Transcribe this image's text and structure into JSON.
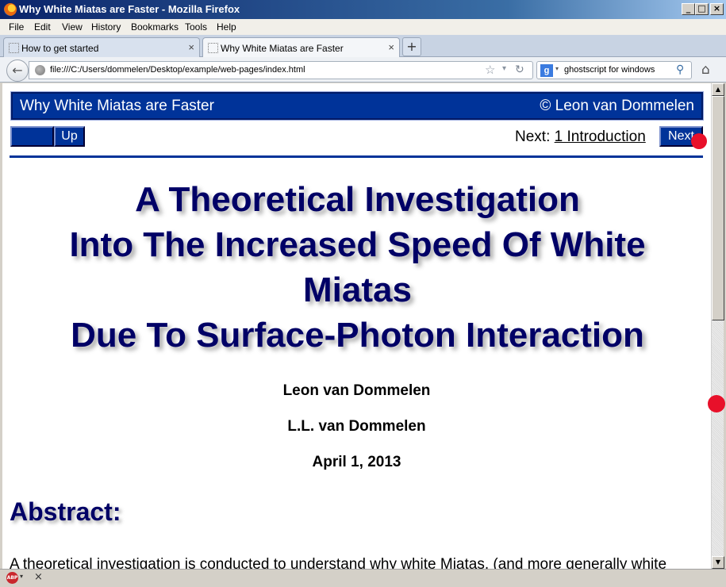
{
  "window": {
    "title": "Why White Miatas are Faster - Mozilla Firefox",
    "min": "_",
    "max": "□",
    "close": "×"
  },
  "menu": [
    "File",
    "Edit",
    "View",
    "History",
    "Bookmarks",
    "Tools",
    "Help"
  ],
  "tabs": [
    {
      "label": "How to get started",
      "close": "×"
    },
    {
      "label": "Why White Miatas are Faster",
      "close": "×"
    }
  ],
  "new_tab": "+",
  "nav": {
    "back": "←",
    "url": "file:///C:/Users/dommelen/Desktop/example/web-pages/index.html",
    "star": "☆",
    "dropdown": "▾",
    "reload": "↻",
    "search_engine": "g",
    "search_dropdown": "▾",
    "search_query": "ghostscript for windows",
    "search_icon": "⚲",
    "home": "⌂"
  },
  "page": {
    "header_left": "Why White Miatas are Faster",
    "header_right": "© Leon van Dommelen",
    "prev_label": "",
    "up_label": "Up",
    "next_prefix": "Next: ",
    "next_link": "1 Introduction",
    "next_button": "Next",
    "title_lines": [
      "A Theoretical Investigation",
      "Into The Increased Speed Of White",
      "Miatas",
      "Due To Surface-Photon Interaction"
    ],
    "author": "Leon van Dommelen",
    "author2": "L.L. van Dommelen",
    "date": "April 1, 2013",
    "abstract_heading": "Abstract:",
    "abstract_text": "A theoretical investigation is conducted to understand why white Miatas, (and more generally white"
  },
  "scrollbar": {
    "up": "▲",
    "down": "▼"
  },
  "addon_bar": {
    "abp": "ABP",
    "dropdown": "▾",
    "close": "×"
  }
}
